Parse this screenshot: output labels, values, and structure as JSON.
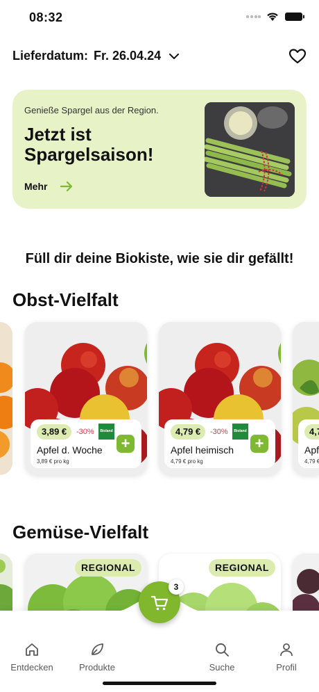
{
  "status": {
    "time": "08:32"
  },
  "header": {
    "delivery_label": "Lieferdatum:",
    "delivery_date": "Fr. 26.04.24"
  },
  "banner": {
    "eyebrow": "Genieße Spargel aus der Region.",
    "headline": "Jetzt ist Spargelsaison!",
    "more_label": "Mehr"
  },
  "tagline": "Füll dir deine Biokiste, wie sie dir gefällt!",
  "fruit": {
    "title": "Obst-Vielfalt",
    "products": [
      {
        "price": "3,89 €",
        "discount": "-30%",
        "badge": "Bioland",
        "name": "Apfel d. Woche",
        "unit_price": "3,89 € pro kg"
      },
      {
        "price": "4,79 €",
        "discount": "-30%",
        "badge": "Bioland",
        "name": "Apfel heimisch",
        "unit_price": "4,79 € pro kg"
      }
    ],
    "partial_right": {
      "price": "4,7",
      "name": "Apf",
      "unit_price": "4,79 €"
    }
  },
  "vegetables": {
    "title": "Gemüse-Vielfalt",
    "badges": [
      "REGIONAL",
      "REGIONAL"
    ]
  },
  "cart": {
    "count": "3"
  },
  "nav": {
    "items": [
      {
        "label": "Entdecken",
        "icon": "home-icon"
      },
      {
        "label": "Produkte",
        "icon": "leaf-icon"
      },
      {
        "label": "Suche",
        "icon": "search-icon"
      },
      {
        "label": "Profil",
        "icon": "profile-icon"
      }
    ]
  },
  "colors": {
    "accent": "#80b72d",
    "banner_bg": "#e7f2c7",
    "pill_bg": "#dcebb0",
    "discount": "#d23a4a"
  }
}
